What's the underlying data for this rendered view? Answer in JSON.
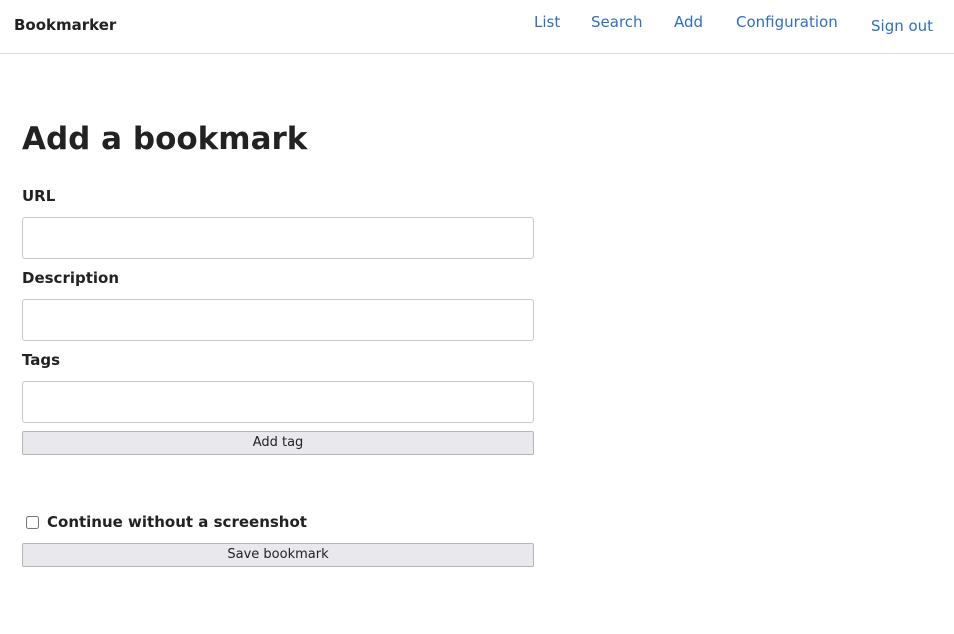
{
  "header": {
    "brand": "Bookmarker",
    "nav": {
      "list": "List",
      "search": "Search",
      "add": "Add",
      "configuration": "Configuration",
      "sign_out": "Sign out"
    },
    "link_color": "#2f6fc2"
  },
  "main": {
    "title": "Add a bookmark",
    "fields": {
      "url_label": "URL",
      "url_value": "",
      "description_label": "Description",
      "description_value": "",
      "tags_label": "Tags",
      "tags_value": ""
    },
    "add_tag_label": "Add tag",
    "screenshot_checkbox_label": "Continue without a screenshot",
    "screenshot_checkbox_checked": false,
    "save_label": "Save bookmark"
  }
}
